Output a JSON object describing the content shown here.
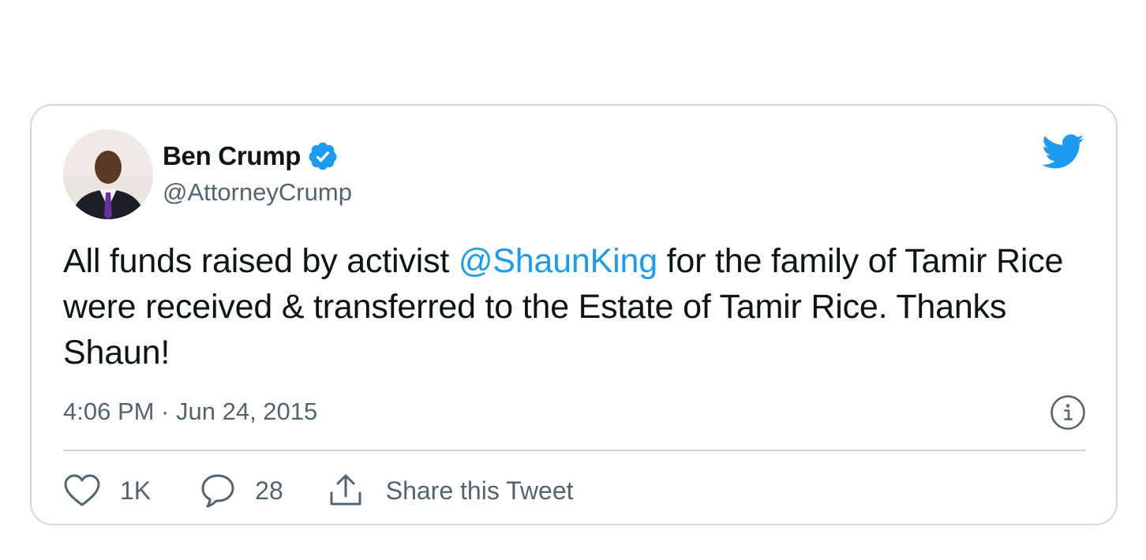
{
  "tweet": {
    "author": {
      "name": "Ben Crump",
      "handle": "@AttorneyCrump",
      "verified": true
    },
    "text_before_mention": "All funds raised by activist ",
    "mention": "@ShaunKing",
    "text_after_mention": " for the family of Tamir Rice were received & transferred to the Estate of Tamir Rice. Thanks Shaun!",
    "timestamp": "4:06 PM · Jun 24, 2015",
    "actions": {
      "like_count": "1K",
      "reply_count": "28",
      "share_label": "Share this Tweet"
    }
  },
  "icons": {
    "brand": "twitter-bird-icon",
    "verified": "verified-badge-icon",
    "info": "info-icon",
    "like": "heart-icon",
    "reply": "speech-bubble-icon",
    "share": "share-upload-icon"
  },
  "colors": {
    "accent": "#1d9bf0",
    "text_primary": "#0f1419",
    "text_secondary": "#536471",
    "border": "#cfd9de"
  }
}
